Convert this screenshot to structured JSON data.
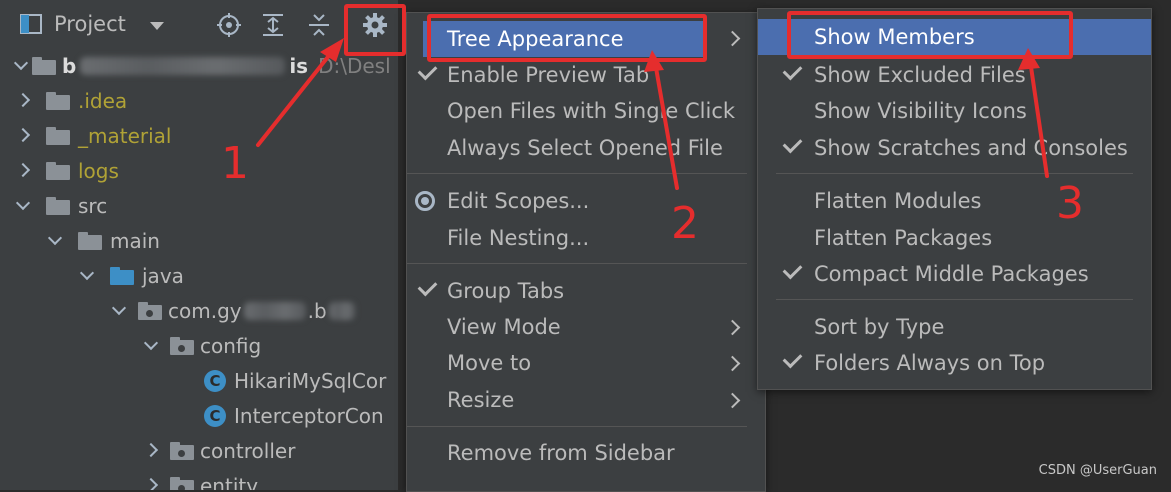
{
  "project_panel": {
    "title": "Project",
    "root": {
      "name_start": "b",
      "name_end": "is",
      "path": "D:\\Desl"
    },
    "tree": [
      {
        "label": ".idea",
        "kind": "folder",
        "color": "yellow"
      },
      {
        "label": "_material",
        "kind": "folder",
        "color": "yellow"
      },
      {
        "label": "logs",
        "kind": "folder",
        "color": "yellow"
      },
      {
        "label": "src",
        "kind": "folder",
        "color": "normal"
      },
      {
        "label": "main",
        "kind": "folder",
        "color": "normal"
      },
      {
        "label": "java",
        "kind": "folder-blue",
        "color": "normal"
      },
      {
        "label": "com.gy",
        "kind": "package",
        "color": "normal",
        "suffix": ".b"
      },
      {
        "label": "config",
        "kind": "package",
        "color": "normal"
      },
      {
        "label": "HikariMySqlCor",
        "kind": "class",
        "color": "normal"
      },
      {
        "label": "InterceptorCon",
        "kind": "class",
        "color": "normal"
      },
      {
        "label": "controller",
        "kind": "package",
        "color": "normal"
      },
      {
        "label": "entity",
        "kind": "package",
        "color": "normal"
      }
    ],
    "class_icon_letter": "C"
  },
  "menu_main": {
    "items": [
      {
        "label": "Tree Appearance",
        "selected": true,
        "submenu": true
      },
      {
        "label": "Enable Preview Tab",
        "checked": true
      },
      {
        "label": "Open Files with Single Click"
      },
      {
        "label": "Always Select Opened File"
      },
      {
        "label": "Edit Scopes...",
        "radio": true
      },
      {
        "label": "File Nesting..."
      },
      {
        "label": "Group Tabs",
        "checked": true
      },
      {
        "label": "View Mode",
        "submenu": true
      },
      {
        "label": "Move to",
        "submenu": true
      },
      {
        "label": "Resize",
        "submenu": true
      },
      {
        "label": "Remove from Sidebar"
      }
    ]
  },
  "menu_sub": {
    "items": [
      {
        "label": "Show Members",
        "selected": true
      },
      {
        "label": "Show Excluded Files",
        "checked": true
      },
      {
        "label": "Show Visibility Icons"
      },
      {
        "label": "Show Scratches and Consoles",
        "checked": true
      },
      {
        "label": "Flatten Modules"
      },
      {
        "label": "Flatten Packages"
      },
      {
        "label": "Compact Middle Packages",
        "checked": true
      },
      {
        "label": "Sort by Type"
      },
      {
        "label": "Folders Always on Top",
        "checked": true
      }
    ]
  },
  "annotations": {
    "step1": "1",
    "step2": "2",
    "step3": "3",
    "color": "#e52d2d"
  },
  "watermark": "CSDN @UserGuan",
  "colors": {
    "selection": "#4b6eaf",
    "panel": "#3c3f41",
    "editor": "#2b2b2b",
    "accent_blue": "#3d8fc6"
  }
}
